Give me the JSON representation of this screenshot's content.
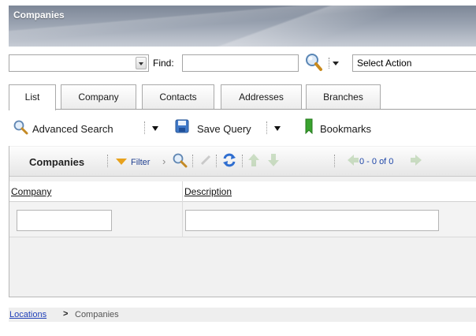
{
  "title": "Companies",
  "find": {
    "label": "Find:",
    "combo_value": "",
    "find_value": "",
    "action_select": "Select Action"
  },
  "tabs": [
    {
      "label": "List",
      "active": true
    },
    {
      "label": "Company",
      "active": false
    },
    {
      "label": "Contacts",
      "active": false
    },
    {
      "label": "Addresses",
      "active": false
    },
    {
      "label": "Branches",
      "active": false
    }
  ],
  "toolbar": {
    "advanced_search": "Advanced Search",
    "save_query": "Save Query",
    "bookmarks": "Bookmarks"
  },
  "grid": {
    "title": "Companies",
    "filter_label": "Filter",
    "page_count": "0 - 0 of 0",
    "columns": [
      "Company",
      "Description"
    ],
    "filter_values": [
      "",
      ""
    ]
  },
  "breadcrumb": {
    "link": "Locations",
    "separator": ">",
    "current": "Companies"
  },
  "icons": {
    "find": "magnifier-icon",
    "bookmark": "bookmark-icon",
    "save": "floppy-disk-icon",
    "refresh": "refresh-icon"
  },
  "colors": {
    "title_bar": "#8b95a5",
    "link": "#1f3fb8",
    "filter_icon": "#e8a21d",
    "bookmark": "#3aa32f"
  }
}
